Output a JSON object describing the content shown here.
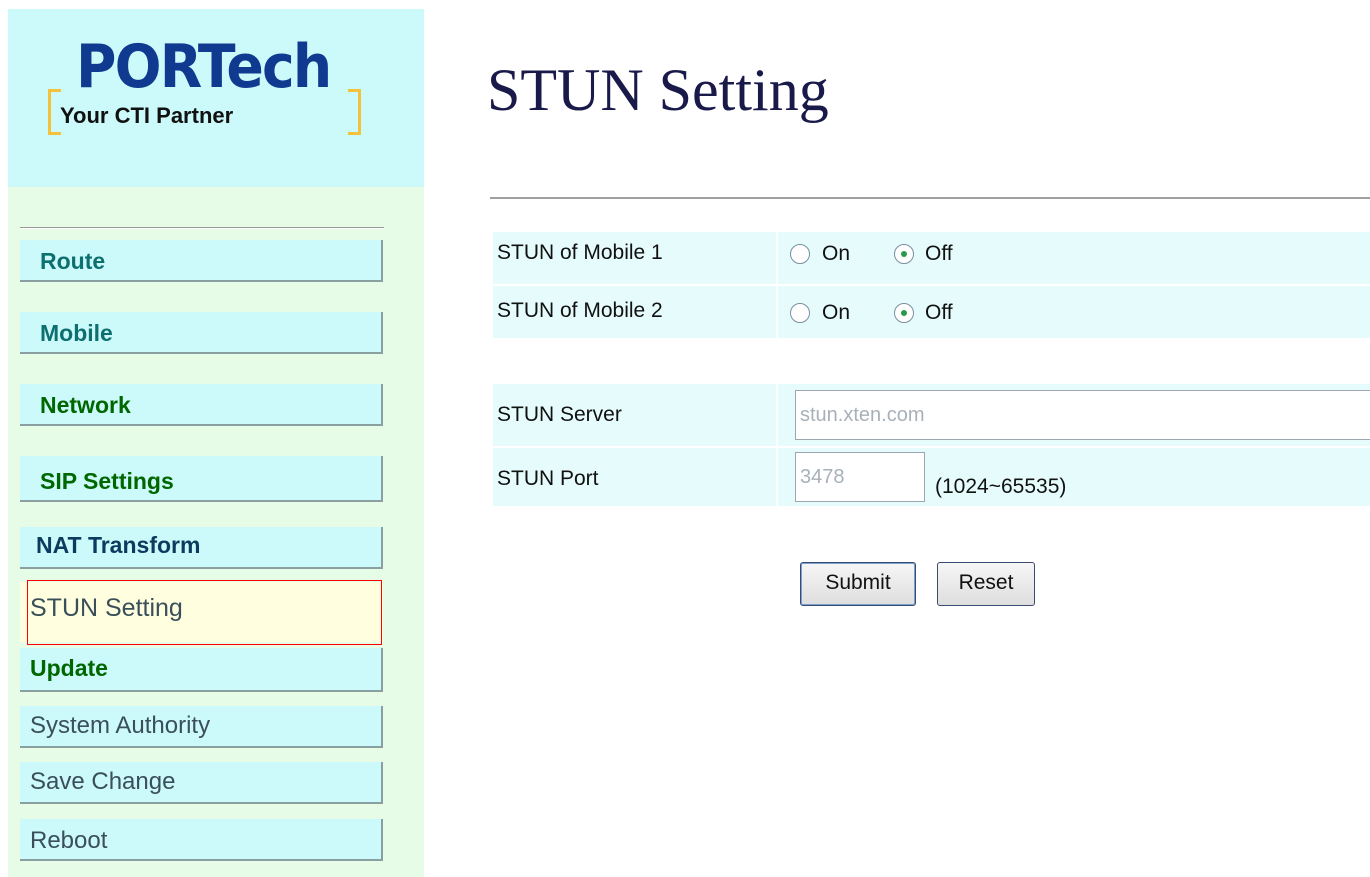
{
  "logo": {
    "brand": "PORTech",
    "tagline": "Your CTI Partner"
  },
  "colors": {
    "logo_accent": "#f4c13a",
    "brand_blue": "#103a8f",
    "active_highlight_border": "#ff0000"
  },
  "sidebar": {
    "items": [
      {
        "label": "Route"
      },
      {
        "label": "Mobile"
      },
      {
        "label": "Network"
      },
      {
        "label": "SIP Settings"
      },
      {
        "label": "NAT Transform"
      },
      {
        "label": "STUN Setting",
        "active": true
      },
      {
        "label": "Update"
      },
      {
        "label": "System Authority"
      },
      {
        "label": "Save Change"
      },
      {
        "label": "Reboot"
      }
    ]
  },
  "page": {
    "title": "STUN Setting"
  },
  "form": {
    "mobile1": {
      "label": "STUN of Mobile 1",
      "on_label": "On",
      "off_label": "Off",
      "selected": "Off"
    },
    "mobile2": {
      "label": "STUN of Mobile 2",
      "on_label": "On",
      "off_label": "Off",
      "selected": "Off"
    },
    "server": {
      "label": "STUN Server",
      "value": "stun.xten.com"
    },
    "port": {
      "label": "STUN Port",
      "value": "3478",
      "range_hint": "(1024~65535)"
    },
    "submit_label": "Submit",
    "reset_label": "Reset"
  }
}
